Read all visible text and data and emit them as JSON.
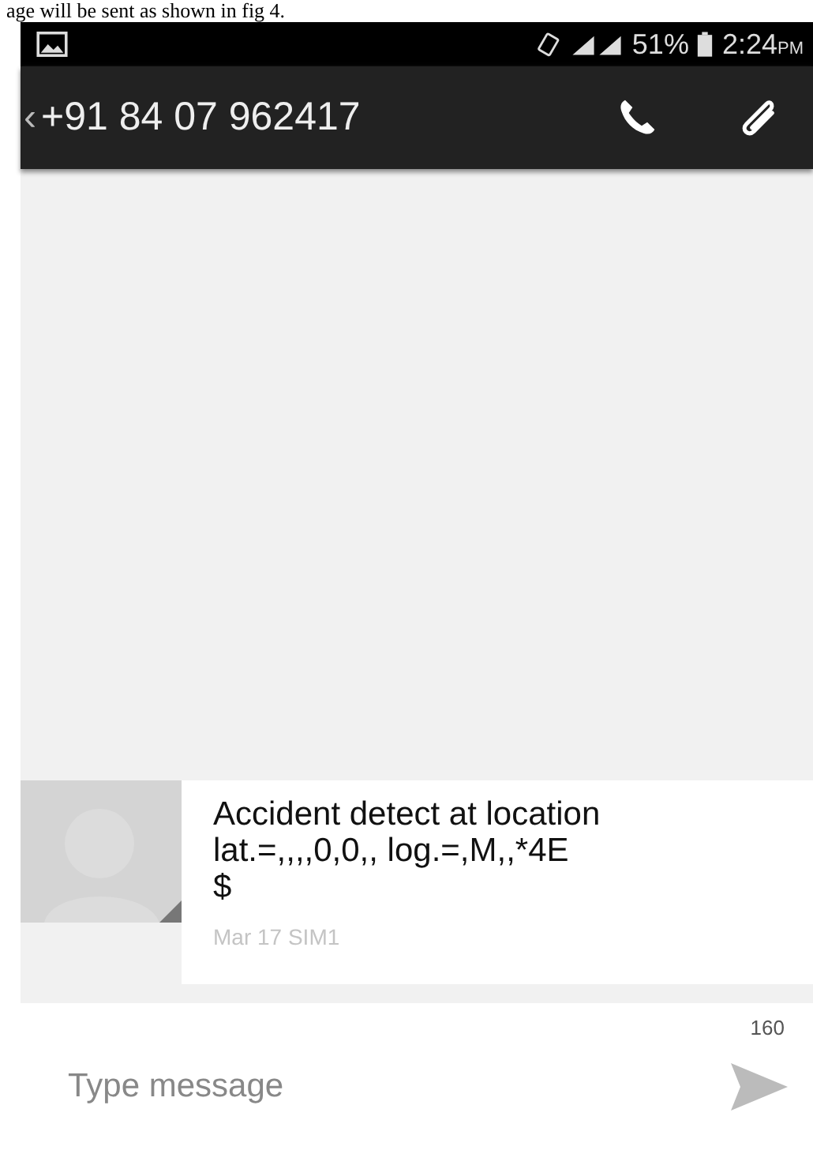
{
  "caption": "age will be sent as shown in fig 4.",
  "status_bar": {
    "battery": "51%",
    "time": "2:24",
    "time_suffix": "PM"
  },
  "header": {
    "back": "‹",
    "contact": "+91 84 07 962417"
  },
  "messages": [
    {
      "text": "Accident detect at location\nlat.=,,,,0,0,,  log.=,M,,*4E\n$",
      "meta": "Mar 17 SIM1"
    }
  ],
  "composer": {
    "counter": "160",
    "placeholder": "Type message"
  }
}
